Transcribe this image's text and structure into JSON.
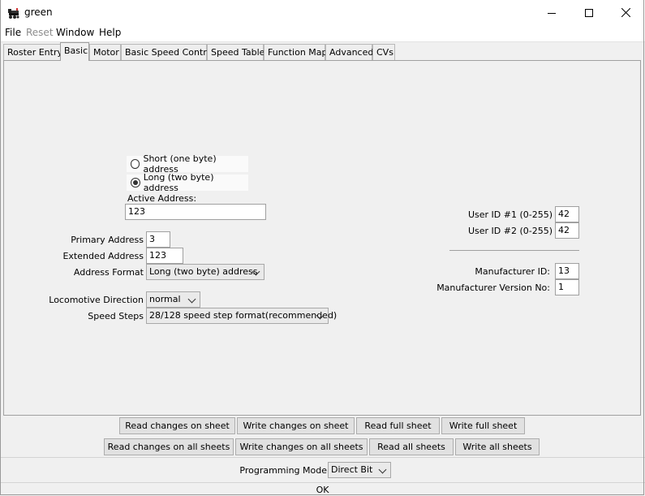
{
  "window": {
    "title": "green",
    "icons": {
      "app": "locomotive-icon",
      "minimize": "minimize-icon",
      "maximize": "maximize-icon",
      "close": "close-icon"
    }
  },
  "menu": {
    "items": [
      "File",
      "Reset",
      "Window",
      "Help"
    ]
  },
  "tabs": [
    "Roster Entry",
    "Basic",
    "Motor",
    "Basic Speed Control",
    "Speed Table",
    "Function Map",
    "Advanced",
    "CVs"
  ],
  "basic": {
    "short_address_label": "Short (one byte) address",
    "long_address_label": "Long (two byte) address",
    "active_address_label": "Active Address:",
    "active_address_value": "123",
    "primary_address_label": "Primary Address",
    "primary_address_value": "3",
    "extended_address_label": "Extended Address",
    "extended_address_value": "123",
    "address_format_label": "Address Format",
    "address_format_value": "Long (two byte) address",
    "direction_label": "Locomotive Direction",
    "direction_value": "normal",
    "speed_steps_label": "Speed Steps",
    "speed_steps_value": "28/128 speed step format(recommended)",
    "user_id1_label": "User ID #1 (0-255)",
    "user_id1_value": "42",
    "user_id2_label": "User ID #2 (0-255)",
    "user_id2_value": "42",
    "manufacturer_id_label": "Manufacturer ID:",
    "manufacturer_id_value": "13",
    "manufacturer_version_label": "Manufacturer Version No:",
    "manufacturer_version_value": "1"
  },
  "buttons": {
    "read_changes_sheet": "Read changes on sheet",
    "write_changes_sheet": "Write changes on sheet",
    "read_full_sheet": "Read full sheet",
    "write_full_sheet": "Write full sheet",
    "read_changes_all": "Read changes on all sheets",
    "write_changes_all": "Write changes on all sheets",
    "read_all": "Read all sheets",
    "write_all": "Write all sheets"
  },
  "programming_mode": {
    "label": "Programming Mode",
    "value": "Direct Bit"
  },
  "status": "OK"
}
